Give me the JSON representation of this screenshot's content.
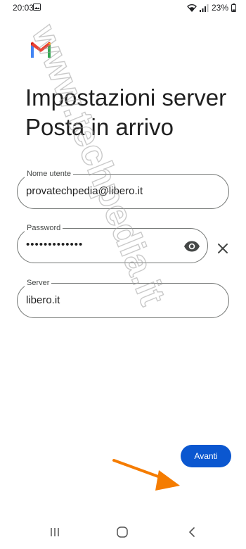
{
  "status_bar": {
    "time": "20:03",
    "battery": "23%"
  },
  "header": {
    "title_line1": "Impostazioni server",
    "title_line2": "Posta in arrivo"
  },
  "form": {
    "username": {
      "label": "Nome utente",
      "value": "provatechpedia@libero.it"
    },
    "password": {
      "label": "Password",
      "value": "•••••••••••••"
    },
    "server": {
      "label": "Server",
      "value": "libero.it"
    }
  },
  "actions": {
    "next_label": "Avanti"
  },
  "watermark": {
    "text": "www.techpedia.it"
  },
  "colors": {
    "accent": "#0b57d0",
    "arrow": "#f57c00",
    "outline": "#747775"
  },
  "icons": {
    "gmail": "gmail-logo-icon",
    "eye": "eye-icon",
    "clear": "close-icon",
    "nav_recents": "recents-icon",
    "nav_home": "home-icon",
    "nav_back": "back-icon"
  }
}
